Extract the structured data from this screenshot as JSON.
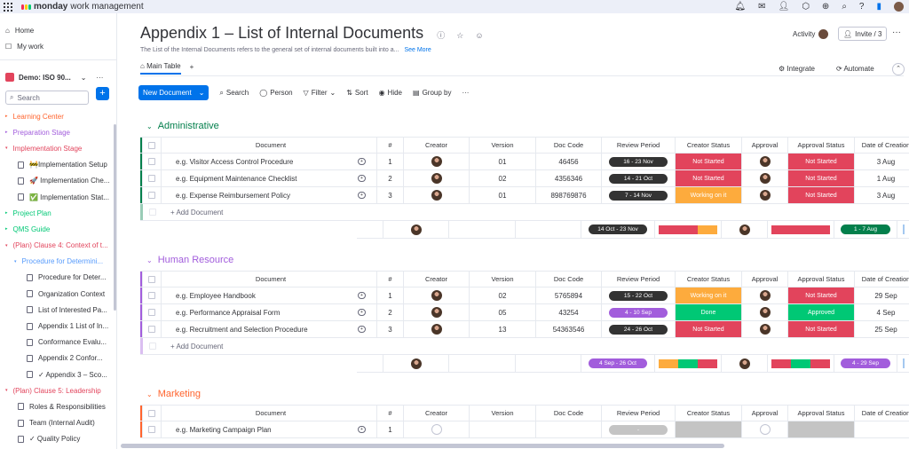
{
  "brand": {
    "name": "monday",
    "suffix": "work management"
  },
  "colors": {
    "accent": "#0073ea",
    "green": "#00c875",
    "orange": "#fdab3d",
    "red": "#e2445c",
    "purple": "#a25ddc",
    "dark": "#333333",
    "admin_group": "#037f4c",
    "hr_group": "#a25ddc",
    "marketing_group": "#ff642e"
  },
  "sidebar": {
    "home": "Home",
    "mywork": "My work",
    "workspace": "Demo: ISO 90...",
    "search_placeholder": "Search",
    "items": [
      {
        "label": "Learning Center",
        "color": "#ff642e",
        "type": "folder"
      },
      {
        "label": "Preparation Stage",
        "color": "#a25ddc",
        "type": "folder"
      },
      {
        "label": "Implementation Stage",
        "color": "#e2445c",
        "type": "folder-open"
      },
      {
        "label": "🚧Implementation Setup",
        "color": "#323338",
        "type": "board"
      },
      {
        "label": "🚀 Implementation Che...",
        "color": "#323338",
        "type": "board"
      },
      {
        "label": "✅ Implementation Stat...",
        "color": "#323338",
        "type": "board"
      },
      {
        "label": "Project Plan",
        "color": "#00c875",
        "type": "folder"
      },
      {
        "label": "QMS Guide",
        "color": "#00c875",
        "type": "folder"
      },
      {
        "label": "(Plan) Clause 4: Context of t...",
        "color": "#e2445c",
        "type": "folder-open"
      },
      {
        "label": "Procedure for Determini...",
        "color": "#579bfc",
        "type": "folder-open"
      },
      {
        "label": "Procedure for Deter...",
        "color": "#323338",
        "type": "doc"
      },
      {
        "label": "Organization Context",
        "color": "#323338",
        "type": "doc"
      },
      {
        "label": "List of Interested Pa...",
        "color": "#323338",
        "type": "doc"
      },
      {
        "label": "Appendix 1 List of In...",
        "color": "#323338",
        "type": "doc"
      },
      {
        "label": "Conformance Evalu...",
        "color": "#323338",
        "type": "doc"
      },
      {
        "label": "Appendix 2 Confor...",
        "color": "#323338",
        "type": "doc"
      },
      {
        "label": "✓ Appendix 3 – Sco...",
        "color": "#323338",
        "type": "doc"
      },
      {
        "label": "(Plan) Clause 5: Leadership",
        "color": "#e2445c",
        "type": "folder-open"
      },
      {
        "label": "Roles & Responsibilities",
        "color": "#323338",
        "type": "board"
      },
      {
        "label": "Team (Internal Audit)",
        "color": "#323338",
        "type": "board"
      },
      {
        "label": "✓ Quality Policy",
        "color": "#323338",
        "type": "board"
      }
    ]
  },
  "board": {
    "title": "Appendix 1 – List of Internal Documents",
    "description": "The List of the Internal Documents refers to the general set of internal documents built into a...",
    "see_more": "See More",
    "activity": "Activity",
    "invite": "Invite / 3",
    "main_tab": "Main Table",
    "integrate": "Integrate",
    "automate": "Automate"
  },
  "toolbar": {
    "new_item": "New Document",
    "search": "Search",
    "person": "Person",
    "filter": "Filter",
    "sort": "Sort",
    "hide": "Hide",
    "group_by": "Group by"
  },
  "columns": {
    "document": "Document",
    "num": "#",
    "creator": "Creator",
    "version": "Version",
    "doc_code": "Doc Code",
    "review_period": "Review Period",
    "creator_status": "Creator Status",
    "approval": "Approval",
    "approval_status": "Approval Status",
    "date_of_creation": "Date of Creation"
  },
  "add_item": "+ Add Document",
  "groups": [
    {
      "name": "Administrative",
      "color": "#037f4c",
      "rows": [
        {
          "doc": "e.g. Visitor Access Control Procedure",
          "num": "1",
          "version": "01",
          "code": "46456",
          "review": "16 - 23 Nov",
          "review_color": "#333333",
          "cstatus": "Not Started",
          "cstatus_color": "#e2445c",
          "astatus": "Not Started",
          "astatus_color": "#e2445c",
          "date": "3 Aug"
        },
        {
          "doc": "e.g. Equipment Maintenance Checklist",
          "num": "2",
          "version": "02",
          "code": "4356346",
          "review": "14 - 21 Oct",
          "review_color": "#333333",
          "cstatus": "Not Started",
          "cstatus_color": "#e2445c",
          "astatus": "Not Started",
          "astatus_color": "#e2445c",
          "date": "1 Aug"
        },
        {
          "doc": "e.g. Expense Reimbursement Policy",
          "num": "3",
          "version": "01",
          "code": "898769876",
          "review": "7 - 14 Nov",
          "review_color": "#333333",
          "cstatus": "Working on it",
          "cstatus_color": "#fdab3d",
          "astatus": "Not Started",
          "astatus_color": "#e2445c",
          "date": "3 Aug"
        }
      ],
      "summary": {
        "review": "14 Oct - 23 Nov",
        "review_color": "#333333",
        "date": "1 - 7 Aug",
        "date_color": "#037f4c"
      }
    },
    {
      "name": "Human Resource",
      "color": "#a25ddc",
      "rows": [
        {
          "doc": "e.g. Employee Handbook",
          "num": "1",
          "version": "02",
          "code": "5765894",
          "review": "15 - 22 Oct",
          "review_color": "#333333",
          "cstatus": "Working on it",
          "cstatus_color": "#fdab3d",
          "astatus": "Not Started",
          "astatus_color": "#e2445c",
          "date": "29 Sep"
        },
        {
          "doc": "e.g. Performance Appraisal Form",
          "num": "2",
          "version": "05",
          "code": "43254",
          "review": "4 - 10 Sep",
          "review_color": "#a25ddc",
          "cstatus": "Done",
          "cstatus_color": "#00c875",
          "astatus": "Approved",
          "astatus_color": "#00c875",
          "date": "4 Sep"
        },
        {
          "doc": "e.g. Recruitment and Selection Procedure",
          "num": "3",
          "version": "13",
          "code": "54363546",
          "review": "24 - 26 Oct",
          "review_color": "#333333",
          "cstatus": "Not Started",
          "cstatus_color": "#e2445c",
          "astatus": "Not Started",
          "astatus_color": "#e2445c",
          "date": "25 Sep"
        }
      ],
      "summary": {
        "review": "4 Sep - 26 Oct",
        "review_color": "#a25ddc",
        "date": "4 - 29 Sep",
        "date_color": "#a25ddc"
      }
    },
    {
      "name": "Marketing",
      "color": "#ff642e",
      "rows": [
        {
          "doc": "e.g. Marketing Campaign Plan",
          "num": "1",
          "version": "",
          "code": "",
          "review": "-",
          "review_color": "#c4c4c4",
          "cstatus": "",
          "cstatus_color": "#c4c4c4",
          "astatus": "",
          "astatus_color": "#c4c4c4",
          "date": "",
          "empty_person": true
        }
      ]
    }
  ]
}
